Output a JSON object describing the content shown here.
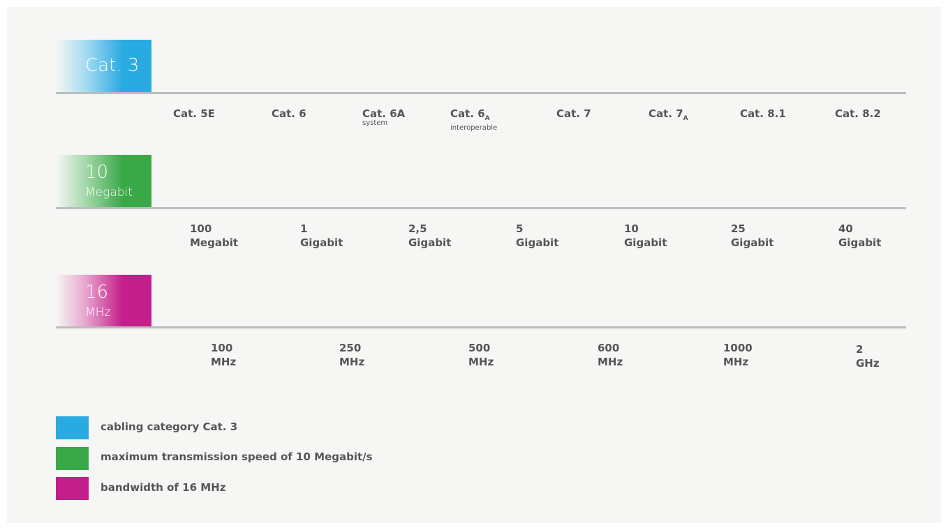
{
  "colors": {
    "cat": "#29abe2",
    "speed": "#39a948",
    "bandwidth": "#c41e8a"
  },
  "categories_row": {
    "tag": "Cat. 3",
    "items": [
      {
        "label": "Cat. 5E"
      },
      {
        "label": "Cat. 6"
      },
      {
        "label": "Cat. 6A",
        "sub": "system"
      },
      {
        "label": "Cat. 6",
        "subscript": "A",
        "sub": "interoperable"
      },
      {
        "label": "Cat. 7"
      },
      {
        "label": "Cat. 7",
        "subscript": "A"
      },
      {
        "label": "Cat. 8.1"
      },
      {
        "label": "Cat. 8.2"
      }
    ]
  },
  "speed_row": {
    "tag_value": "10",
    "tag_unit": "Megabit",
    "items": [
      {
        "value": "100",
        "unit": "Megabit"
      },
      {
        "value": "1",
        "unit": "Gigabit"
      },
      {
        "value": "2,5",
        "unit": "Gigabit"
      },
      {
        "value": "5",
        "unit": "Gigabit"
      },
      {
        "value": "10",
        "unit": "Gigabit"
      },
      {
        "value": "25",
        "unit": "Gigabit"
      },
      {
        "value": "40",
        "unit": "Gigabit"
      }
    ]
  },
  "bandwidth_row": {
    "tag_value": "16",
    "tag_unit": "MHz",
    "items": [
      {
        "value": "100",
        "unit": "MHz"
      },
      {
        "value": "250",
        "unit": "MHz"
      },
      {
        "value": "500",
        "unit": "MHz"
      },
      {
        "value": "600",
        "unit": "MHz"
      },
      {
        "value": "1000",
        "unit": "MHz"
      },
      {
        "value": "2",
        "unit": "GHz"
      }
    ]
  },
  "legend": [
    {
      "text": "cabling category Cat. 3"
    },
    {
      "text": "maximum transmission speed of 10 Megabit/s"
    },
    {
      "text": "bandwidth of 16 MHz"
    }
  ]
}
